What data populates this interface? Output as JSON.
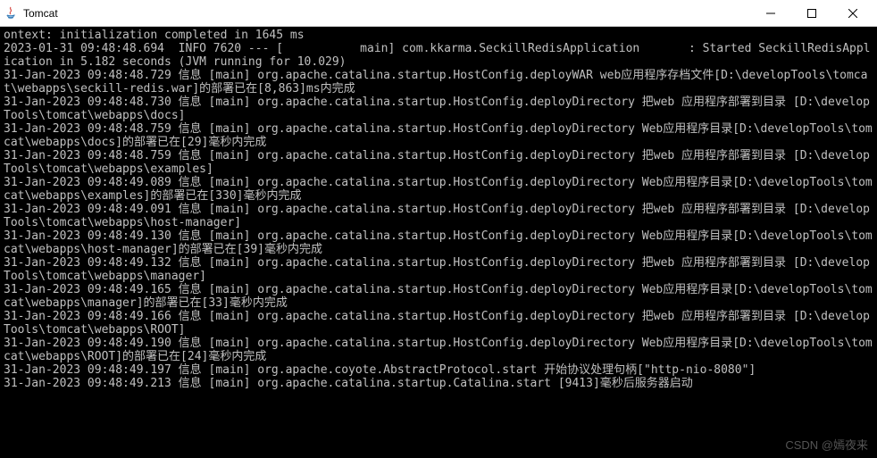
{
  "window": {
    "title": "Tomcat"
  },
  "watermark": "CSDN @嫣夜来",
  "console": {
    "lines": [
      "ontext: initialization completed in 1645 ms",
      "2023-01-31 09:48:48.694  INFO 7620 --- [           main] com.kkarma.SeckillRedisApplication       : Started SeckillRedisApplication in 5.182 seconds (JVM running for 10.029)",
      "31-Jan-2023 09:48:48.729 信息 [main] org.apache.catalina.startup.HostConfig.deployWAR web应用程序存档文件[D:\\developTools\\tomcat\\webapps\\seckill-redis.war]的部署已在[8,863]ms内完成",
      "31-Jan-2023 09:48:48.730 信息 [main] org.apache.catalina.startup.HostConfig.deployDirectory 把web 应用程序部署到目录 [D:\\developTools\\tomcat\\webapps\\docs]",
      "31-Jan-2023 09:48:48.759 信息 [main] org.apache.catalina.startup.HostConfig.deployDirectory Web应用程序目录[D:\\developTools\\tomcat\\webapps\\docs]的部署已在[29]毫秒内完成",
      "31-Jan-2023 09:48:48.759 信息 [main] org.apache.catalina.startup.HostConfig.deployDirectory 把web 应用程序部署到目录 [D:\\developTools\\tomcat\\webapps\\examples]",
      "31-Jan-2023 09:48:49.089 信息 [main] org.apache.catalina.startup.HostConfig.deployDirectory Web应用程序目录[D:\\developTools\\tomcat\\webapps\\examples]的部署已在[330]毫秒内完成",
      "31-Jan-2023 09:48:49.091 信息 [main] org.apache.catalina.startup.HostConfig.deployDirectory 把web 应用程序部署到目录 [D:\\developTools\\tomcat\\webapps\\host-manager]",
      "31-Jan-2023 09:48:49.130 信息 [main] org.apache.catalina.startup.HostConfig.deployDirectory Web应用程序目录[D:\\developTools\\tomcat\\webapps\\host-manager]的部署已在[39]毫秒内完成",
      "31-Jan-2023 09:48:49.132 信息 [main] org.apache.catalina.startup.HostConfig.deployDirectory 把web 应用程序部署到目录 [D:\\developTools\\tomcat\\webapps\\manager]",
      "31-Jan-2023 09:48:49.165 信息 [main] org.apache.catalina.startup.HostConfig.deployDirectory Web应用程序目录[D:\\developTools\\tomcat\\webapps\\manager]的部署已在[33]毫秒内完成",
      "31-Jan-2023 09:48:49.166 信息 [main] org.apache.catalina.startup.HostConfig.deployDirectory 把web 应用程序部署到目录 [D:\\developTools\\tomcat\\webapps\\ROOT]",
      "31-Jan-2023 09:48:49.190 信息 [main] org.apache.catalina.startup.HostConfig.deployDirectory Web应用程序目录[D:\\developTools\\tomcat\\webapps\\ROOT]的部署已在[24]毫秒内完成",
      "31-Jan-2023 09:48:49.197 信息 [main] org.apache.coyote.AbstractProtocol.start 开始协议处理句柄[\"http-nio-8080\"]",
      "31-Jan-2023 09:48:49.213 信息 [main] org.apache.catalina.startup.Catalina.start [9413]毫秒后服务器启动"
    ]
  }
}
